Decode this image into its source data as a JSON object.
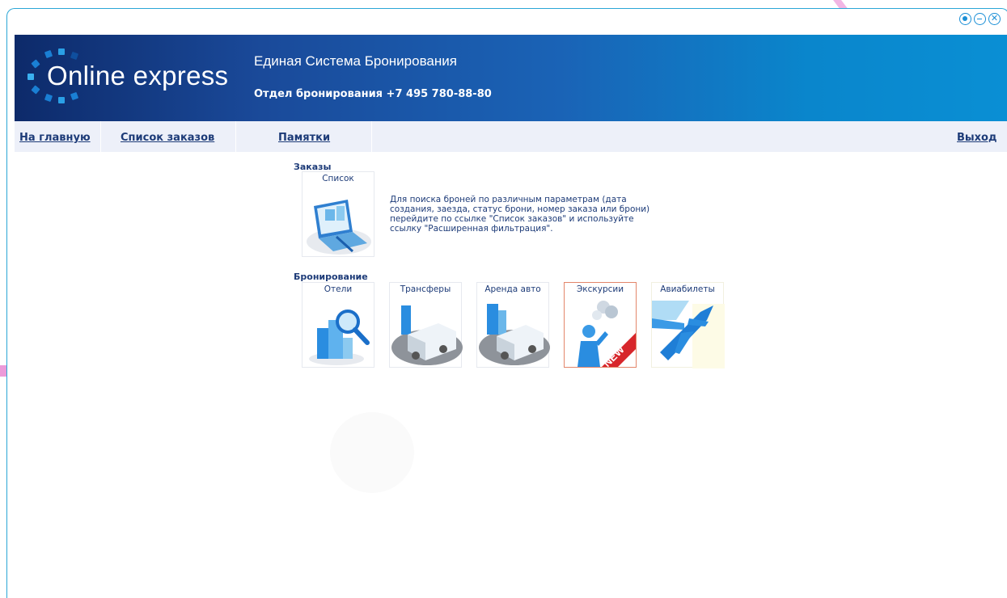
{
  "window": {
    "controls": [
      {
        "name": "record",
        "icon": "record-icon"
      },
      {
        "name": "minimize",
        "icon": "minimize-icon"
      },
      {
        "name": "close",
        "icon": "close-icon",
        "glyph": "✕"
      }
    ]
  },
  "header": {
    "logo_text_light": "Online ",
    "logo_text_bold": "express",
    "title": "Единая Система Бронирования",
    "phone": "Отдел бронирования +7 495 780-88-80"
  },
  "nav": {
    "home": "На главную",
    "orders": "Список заказов",
    "notes": "Памятки",
    "logout": "Выход"
  },
  "orders_section": {
    "title": "Заказы",
    "list_tile": "Список",
    "description": "Для поиска броней по различным параметрам (дата создания, заезда, статус брони, номер заказа или брони) перейдите по ссылке \"Список заказов\" и используйте ссылку \"Расширенная фильтрация\"."
  },
  "booking_section": {
    "title": "Бронирование",
    "tiles": [
      {
        "label": "Отели",
        "icon": "hotel-search-icon"
      },
      {
        "label": "Трансферы",
        "icon": "transfer-bus-icon"
      },
      {
        "label": "Аренда авто",
        "icon": "car-rental-icon"
      },
      {
        "label": "Экскурсии",
        "icon": "excursion-icon",
        "badge": "NEW"
      },
      {
        "label": "Авиабилеты",
        "icon": "airplane-icon"
      }
    ]
  },
  "colors": {
    "accent": "#1a8fd6",
    "nav_text": "#1d3b78",
    "nav_bg": "#edf0f9",
    "new_badge": "#d7262b"
  }
}
